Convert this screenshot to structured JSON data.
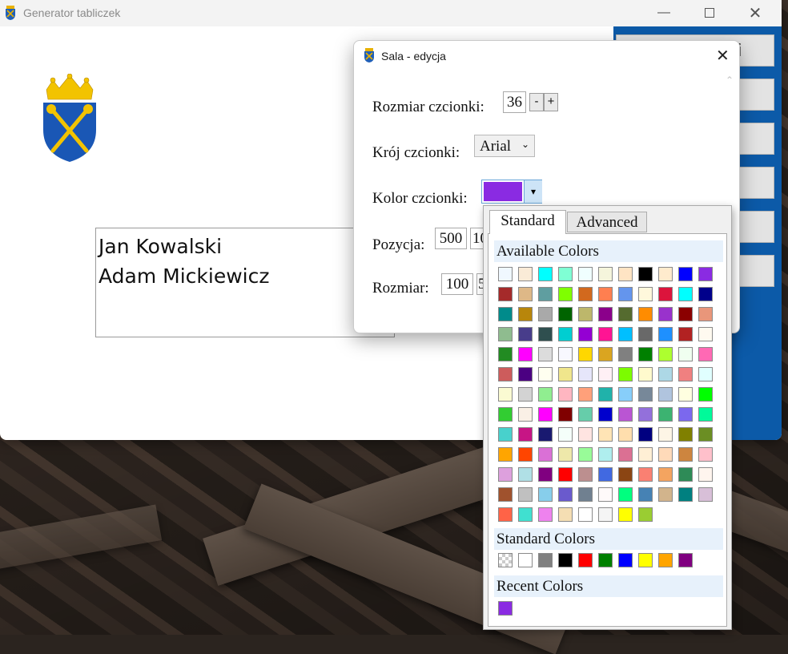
{
  "window": {
    "title": "Generator tabliczek"
  },
  "main": {
    "names": [
      "Jan Kowalski",
      "Adam Mickiewicz"
    ],
    "right_panel_button_text": "i"
  },
  "dialog": {
    "title": "Sala - edycja",
    "font_size_label": "Rozmiar czcionki:",
    "font_size_value": "36",
    "decrement_label": "-",
    "increment_label": "+",
    "font_family_label": "Krój czcionki:",
    "font_family_value": "Arial",
    "font_color_label": "Kolor czcionki:",
    "font_color_value": "#8A2BE2",
    "position_label": "Pozycja:",
    "position_x": "500",
    "position_y": "10",
    "size_label": "Rozmiar:",
    "size_w": "100",
    "size_h": "5"
  },
  "picker": {
    "tabs": [
      "Standard",
      "Advanced"
    ],
    "available_label": "Available Colors",
    "standard_label": "Standard Colors",
    "recent_label": "Recent Colors",
    "available_colors": [
      "#F0F8FF",
      "#FAEBD7",
      "#00FFFF",
      "#7FFFD4",
      "#F0FFFF",
      "#F5F5DC",
      "#FFE4C4",
      "#000000",
      "#FFEBCD",
      "#0000FF",
      "#8A2BE2",
      "#A52A2A",
      "#DEB887",
      "#5F9EA0",
      "#7FFF00",
      "#D2691E",
      "#FF7F50",
      "#6495ED",
      "#FFF8DC",
      "#DC143C",
      "#00FFFF",
      "#00008B",
      "#008B8B",
      "#B8860B",
      "#A9A9A9",
      "#006400",
      "#BDB76B",
      "#8B008B",
      "#556B2F",
      "#FF8C00",
      "#9932CC",
      "#8B0000",
      "#E9967A",
      "#8FBC8F",
      "#483D8B",
      "#2F4F4F",
      "#00CED1",
      "#9400D3",
      "#FF1493",
      "#00BFFF",
      "#696969",
      "#1E90FF",
      "#B22222",
      "#FFFAF0",
      "#228B22",
      "#FF00FF",
      "#DCDCDC",
      "#F8F8FF",
      "#FFD700",
      "#DAA520",
      "#808080",
      "#008000",
      "#ADFF2F",
      "#F0FFF0",
      "#FF69B4",
      "#CD5C5C",
      "#4B0082",
      "#FFFFF0",
      "#F0E68C",
      "#E6E6FA",
      "#FFF0F5",
      "#7CFC00",
      "#FFFACD",
      "#ADD8E6",
      "#F08080",
      "#E0FFFF",
      "#FAFAD2",
      "#D3D3D3",
      "#90EE90",
      "#FFB6C1",
      "#FFA07A",
      "#20B2AA",
      "#87CEFA",
      "#778899",
      "#B0C4DE",
      "#FFFFE0",
      "#00FF00",
      "#32CD32",
      "#FAF0E6",
      "#FF00FF",
      "#800000",
      "#66CDAA",
      "#0000CD",
      "#BA55D3",
      "#9370DB",
      "#3CB371",
      "#7B68EE",
      "#00FA9A",
      "#48D1CC",
      "#C71585",
      "#191970",
      "#F5FFFA",
      "#FFE4E1",
      "#FFE4B5",
      "#FFDEAD",
      "#000080",
      "#FDF5E6",
      "#808000",
      "#6B8E23",
      "#FFA500",
      "#FF4500",
      "#DA70D6",
      "#EEE8AA",
      "#98FB98",
      "#AFEEEE",
      "#DB7093",
      "#FFEFD5",
      "#FFDAB9",
      "#CD853F",
      "#FFC0CB",
      "#DDA0DD",
      "#B0E0E6",
      "#800080",
      "#FF0000",
      "#BC8F8F",
      "#4169E1",
      "#8B4513",
      "#FA8072",
      "#F4A460",
      "#2E8B57",
      "#FFF5EE",
      "#A0522D",
      "#C0C0C0",
      "#87CEEB",
      "#6A5ACD",
      "#708090",
      "#FFFAFA",
      "#00FF7F",
      "#4682B4",
      "#D2B48C",
      "#008080",
      "#D8BFD8",
      "#FF6347",
      "#40E0D0",
      "#EE82EE",
      "#F5DEB3",
      "#FFFFFF",
      "#F5F5F5",
      "#FFFF00",
      "#9ACD32"
    ],
    "standard_colors": [
      "transparent",
      "#FFFFFF",
      "#808080",
      "#000000",
      "#FF0000",
      "#008000",
      "#0000FF",
      "#FFFF00",
      "#FFA500",
      "#800080"
    ],
    "recent_colors": [
      "#8A2BE2"
    ]
  },
  "icons": {
    "app": "crest-icon",
    "minimize": "minimize-icon",
    "maximize": "maximize-icon",
    "close": "close-icon"
  }
}
